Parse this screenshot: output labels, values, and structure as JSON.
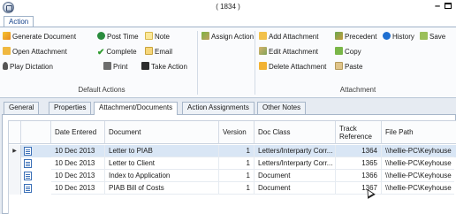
{
  "window": {
    "title": "( 1834 )"
  },
  "ribbon_tabs": [
    "Action"
  ],
  "ribbon": {
    "default_actions": {
      "group_label": "Default Actions",
      "generate_document": "Generate Document",
      "post_time": "Post Time",
      "note": "Note",
      "open_attachment": "Open Attachment",
      "complete": "Complete",
      "email": "Email",
      "play_dictation": "Play Dictation",
      "print": "Print",
      "take_action": "Take Action"
    },
    "assign_action": "Assign Action",
    "attachment": {
      "group_label": "Attachment",
      "add_attachment": "Add Attachment",
      "edit_attachment": "Edit Attachment",
      "delete_attachment": "Delete Attachment",
      "precedent": "Precedent",
      "copy": "Copy",
      "paste": "Paste",
      "history": "History",
      "save": "Save"
    }
  },
  "doc_tabs": [
    "General",
    "Properties",
    "Attachment/Documents",
    "Action Assignments",
    "Other Notes"
  ],
  "grid": {
    "columns": [
      "Date Entered",
      "Document",
      "Version",
      "Doc Class",
      "Track Reference",
      "File Path"
    ],
    "rows": [
      {
        "date": "10 Dec 2013",
        "document": "Letter to PIAB",
        "version": "1",
        "doc_class": "Letters/Interparty Corr...",
        "track": "1364",
        "path": "\\\\hellie-PC\\Keyhouse"
      },
      {
        "date": "10 Dec 2013",
        "document": "Letter to Client",
        "version": "1",
        "doc_class": "Letters/Interparty Corr...",
        "track": "1365",
        "path": "\\\\hellie-PC\\Keyhouse"
      },
      {
        "date": "10 Dec 2013",
        "document": "Index to Application",
        "version": "1",
        "doc_class": "Document",
        "track": "1366",
        "path": "\\\\hellie-PC\\Keyhouse"
      },
      {
        "date": "10 Dec 2013",
        "document": "PIAB Bill of Costs",
        "version": "1",
        "doc_class": "Document",
        "track": "1367",
        "path": "\\\\hellie-PC\\Keyhouse"
      }
    ]
  }
}
